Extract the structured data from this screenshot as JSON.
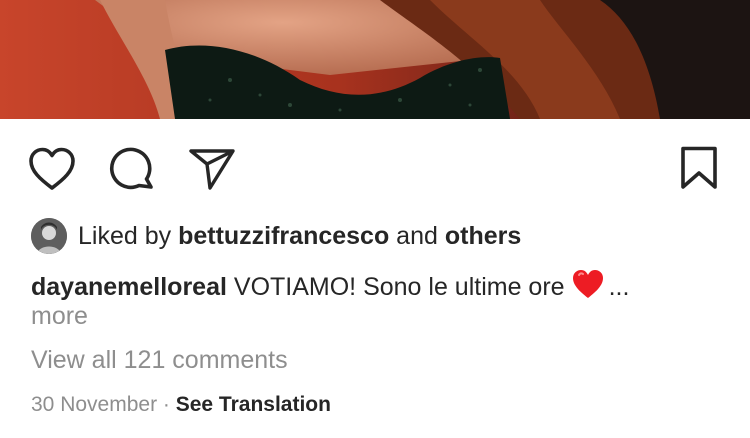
{
  "post": {
    "media": {
      "description_icon": "photo-image"
    },
    "actions": {
      "like_icon": "heart-outline-icon",
      "comment_icon": "comment-bubble-icon",
      "share_icon": "paper-plane-icon",
      "save_icon": "bookmark-icon"
    },
    "likes": {
      "prefix": "Liked by ",
      "user": "bettuzzifrancesco",
      "joiner": " and ",
      "others": "others"
    },
    "caption": {
      "username": "dayanemelloreal",
      "text": "VOTIAMO! Sono le ultime ore",
      "emoji": "red-heart-emoji",
      "ellipsis": "...",
      "more": "more"
    },
    "view_comments": "View all 121 comments",
    "date": "30 November",
    "separator": " · ",
    "see_translation": "See Translation"
  },
  "colors": {
    "text": "#262626",
    "secondary": "#8e8e8e",
    "heart": "#ed1c24"
  }
}
